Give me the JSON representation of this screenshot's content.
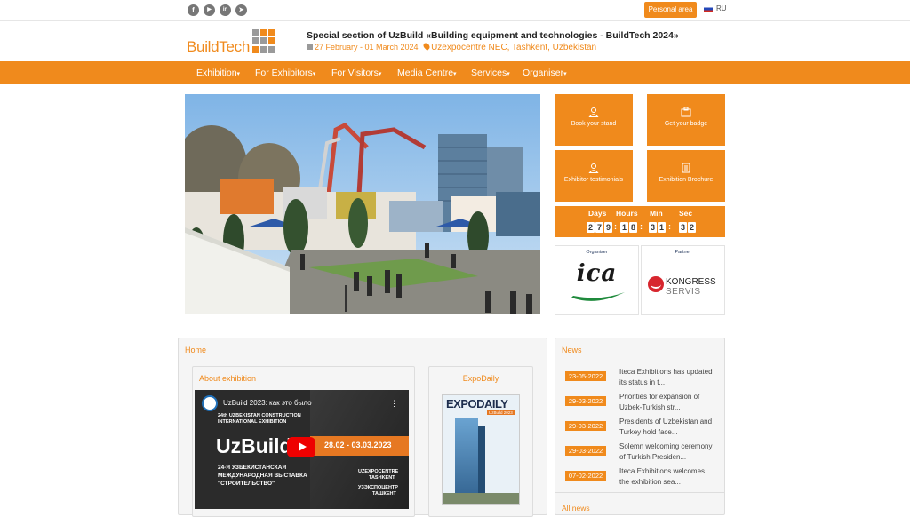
{
  "topbar": {
    "social": [
      {
        "icon": "facebook-icon",
        "glyph": "f"
      },
      {
        "icon": "youtube-icon",
        "glyph": "▶"
      },
      {
        "icon": "linkedin-icon",
        "glyph": "in"
      },
      {
        "icon": "telegram-icon",
        "glyph": "➤"
      }
    ],
    "personal_area": "Personal area",
    "language": "RU"
  },
  "header": {
    "logo_text": "BuildTech",
    "title": "Special section of UzBuild «Building equipment and technologies - BuildTech 2024»",
    "dates": "27 February - 01 March 2024",
    "venue": "Uzexpocentre NEC, Tashkent, Uzbekistan"
  },
  "nav": [
    "Exhibition",
    "For Exhibitors",
    "For Visitors",
    "Media Centre",
    "Services",
    "Organiser"
  ],
  "tiles": {
    "book_stand": "Book your stand",
    "get_badge": "Get your badge",
    "testimonials": "Exhibitor testimonials",
    "brochure": "Exhibition Brochure"
  },
  "countdown": {
    "labels": {
      "days": "Days",
      "hours": "Hours",
      "min": "Min",
      "sec": "Sec"
    },
    "values": {
      "days": "279",
      "hours": "18",
      "min": "31",
      "sec": "32"
    }
  },
  "sponsors": {
    "organiser_label": "Organiser",
    "organiser_logo": "ica",
    "organiser_sub": "eurasia",
    "partner_label": "Partner",
    "partner_name": "KONGRESS",
    "partner_sub": "SERVIS"
  },
  "home": {
    "title": "Home",
    "about_title": "About exhibition",
    "expodaily_title": "ExpoDaily",
    "video": {
      "title": "UzBuild 2023: как это было",
      "line1": "24th UZBEKISTAN CONSTRUCTION",
      "line2": "INTERNATIONAL EXHIBITION",
      "brand": "UzBuild",
      "dates": "28.02 - 03.03.2023",
      "ru1": "24-Я УЗБЕКИСТАНСКАЯ",
      "ru2": "МЕЖДУНАРОДНАЯ ВЫСТАВКА",
      "ru3": "\"СТРОИТЕЛЬСТВО\"",
      "venue1": "UZEXPOCENTRE",
      "venue2": "TASHKENT",
      "venue3": "УЗЭКСПОЦЕНТР",
      "venue4": "ТАШКЕНТ"
    },
    "magazine": {
      "brand": "EXPODAILY",
      "sub": "UzBuild 2023"
    }
  },
  "news": {
    "title": "News",
    "items": [
      {
        "date": "23-05-2022",
        "l1": "Iteca Exhibitions has updated",
        "l2": "its status in t..."
      },
      {
        "date": "29-03-2022",
        "l1": "Priorities for expansion of",
        "l2": "Uzbek-Turkish str..."
      },
      {
        "date": "29-03-2022",
        "l1": "Presidents of Uzbekistan and",
        "l2": "Turkey hold face..."
      },
      {
        "date": "29-03-2022",
        "l1": "Solemn welcoming ceremony",
        "l2": "of Turkish Presiden..."
      },
      {
        "date": "07-02-2022",
        "l1": "Iteca Exhibitions welcomes",
        "l2": "the exhibition sea..."
      }
    ],
    "all_news": "All news"
  },
  "colors": {
    "accent": "#f08a1c",
    "logo_grey": "#9a9a9a"
  }
}
